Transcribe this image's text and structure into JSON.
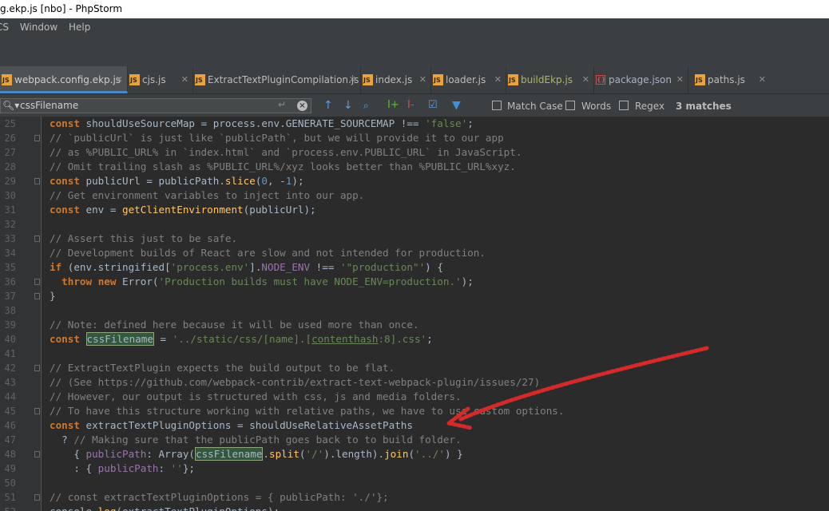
{
  "window": {
    "title": "g.ekp.js [nbo] - PhpStorm"
  },
  "menu": [
    "CS",
    "Window",
    "Help"
  ],
  "tabs": [
    {
      "label": "webpack.config.ekp.js",
      "icon": "js-file-icon",
      "active": true
    },
    {
      "label": "cjs.js",
      "icon": "js-file-icon"
    },
    {
      "label": "ExtractTextPluginCompilation.js",
      "icon": "js-file-icon"
    },
    {
      "label": "index.js",
      "icon": "js-file-icon"
    },
    {
      "label": "loader.js",
      "icon": "js-file-icon"
    },
    {
      "label": "buildEkp.js",
      "icon": "js-file-icon"
    },
    {
      "label": "package.json",
      "icon": "json-file-icon"
    },
    {
      "label": "paths.js",
      "icon": "js-file-icon"
    }
  ],
  "search": {
    "value": "cssFilename",
    "options": [
      "Match Case",
      "Words",
      "Regex"
    ],
    "matches": "3 matches"
  },
  "editor": {
    "first_line": 25,
    "lines": [
      "const shouldUseSourceMap = process.env.GENERATE_SOURCEMAP !== 'false';",
      "// `publicUrl` is just like `publicPath`, but we will provide it to our app",
      "// as %PUBLIC_URL% in `index.html` and `process.env.PUBLIC_URL` in JavaScript.",
      "// Omit trailing slash as %PUBLIC_URL%/xyz looks better than %PUBLIC_URL%xyz.",
      "const publicUrl = publicPath.slice(0, -1);",
      "// Get environment variables to inject into our app.",
      "const env = getClientEnvironment(publicUrl);",
      "",
      "// Assert this just to be safe.",
      "// Development builds of React are slow and not intended for production.",
      "if (env.stringified['process.env'].NODE_ENV !== '\"production\"') {",
      "  throw new Error('Production builds must have NODE_ENV=production.');",
      "}",
      "",
      "// Note: defined here because it will be used more than once.",
      "const cssFilename = '../static/css/[name].[contenthash:8].css';",
      "",
      "// ExtractTextPlugin expects the build output to be flat.",
      "// (See https://github.com/webpack-contrib/extract-text-webpack-plugin/issues/27)",
      "// However, our output is structured with css, js and media folders.",
      "// To have this structure working with relative paths, we have to use custom options.",
      "const extractTextPluginOptions = shouldUseRelativeAssetPaths",
      "  ? // Making sure that the publicPath goes back to to build folder.",
      "    { publicPath: Array(cssFilename.split('/').length).join('../') }",
      "    : { publicPath: ''};",
      "",
      "// const extractTextPluginOptions = { publicPath: './'};",
      "console.log(extractTextPluginOptions);"
    ]
  },
  "colors": {
    "accent": "#4a88c7",
    "arrow": "#d42a2a",
    "match_bg": "#32593d"
  }
}
